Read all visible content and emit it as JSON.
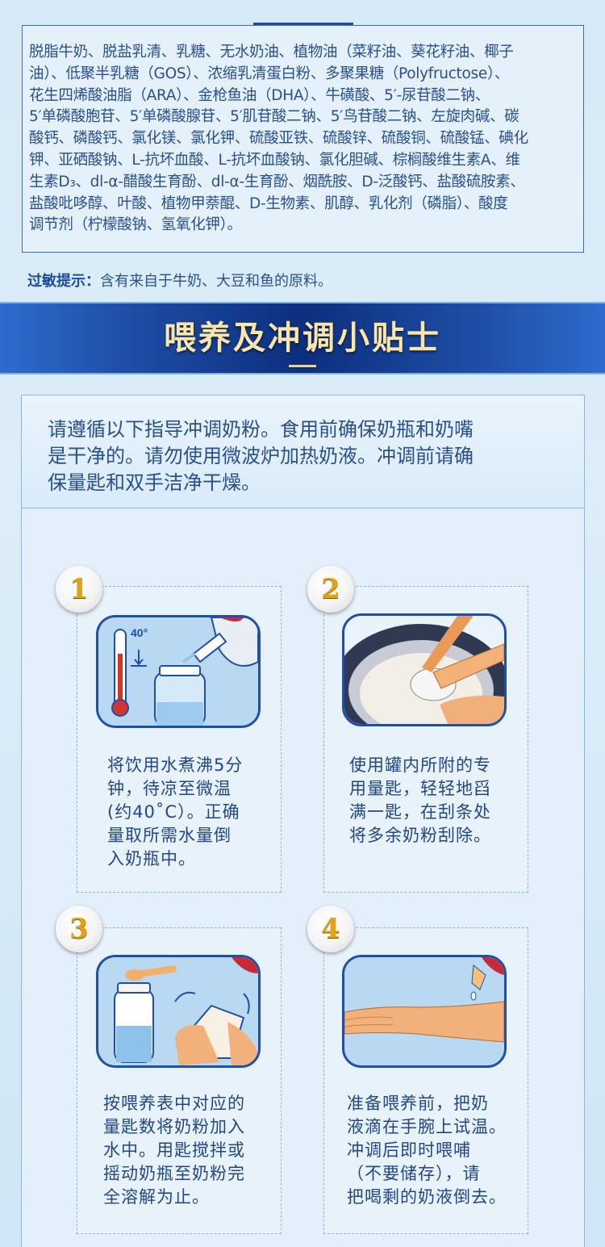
{
  "ingredients": {
    "lines": [
      "脱脂牛奶、脱盐乳清、乳糖、无水奶油、植物油（菜籽油、葵花籽油、椰子",
      "油）、低聚半乳糖（GOS）、浓缩乳清蛋白粉、多聚果糖（Polyfructose）、",
      "花生四烯酸油脂（ARA）、金枪鱼油（DHA）、牛磺酸、5′-尿苷酸二钠、",
      "5′单磷酸胞苷、5′单磷酸腺苷、5′肌苷酸二钠、5′鸟苷酸二钠、左旋肉碱、碳",
      "酸钙、磷酸钙、氯化镁、氯化钾、硫酸亚铁、硫酸锌、硫酸铜、硫酸锰、碘化",
      "钾、亚硒酸钠、L-抗坏血酸、L-抗坏血酸钠、氯化胆碱、棕榈酸维生素A、维",
      "生素D₃、dl-α-醋酸生育酚、dl-α-生育酚、烟酰胺、D-泛酸钙、盐酸硫胺素、",
      "盐酸吡哆醇、叶酸、植物甲萘醌、D-生物素、肌醇、乳化剂（磷脂）、酸度",
      "调节剂（柠檬酸钠、氢氧化钾）。"
    ]
  },
  "allergy": {
    "label": "过敏提示：",
    "text": "含有来自于牛奶、大豆和鱼的原料。"
  },
  "banner": {
    "title": "喂养及冲调小贴士"
  },
  "tips": {
    "intro_lines": [
      "请遵循以下指导冲调奶粉。食用前确保奶瓶和奶嘴",
      "是干净的。请勿使用微波炉加热奶液。冲调前请确",
      "保量匙和双手洁净干燥。"
    ],
    "steps": [
      {
        "number": "1",
        "illustration": "thermometer-kettle-bottle-illustration",
        "thermometer_label": "40°",
        "lines": [
          "将饮用水煮沸5分",
          "钟，待凉至微温",
          "(约40˚C）。正确",
          "量取所需水量倒",
          "入奶瓶中。"
        ]
      },
      {
        "number": "2",
        "illustration": "scoop-leveling-illustration",
        "lines": [
          "使用罐内所附的专",
          "用量匙，轻轻地舀",
          "满一匙，在刮条处",
          "将多余奶粉刮除。"
        ]
      },
      {
        "number": "3",
        "illustration": "scoop-into-bottle-shaking-illustration",
        "lines": [
          "按喂养表中对应的",
          "量匙数将奶粉加入",
          "水中。用匙搅拌或",
          "摇动奶瓶至奶粉完",
          "全溶解为止。"
        ]
      },
      {
        "number": "4",
        "illustration": "wrist-temperature-test-illustration",
        "lines": [
          "准备喂养前，把奶",
          "液滴在手腕上试温。",
          "冲调后即时喂哺",
          "（不要储存），请",
          "把喝剩的奶液倒去。"
        ]
      }
    ]
  },
  "colors": {
    "accent": "#1f4fa8",
    "banner_text": "#fbe6a8",
    "badge_digit": "#e0a317",
    "text": "#2a4f8f"
  }
}
